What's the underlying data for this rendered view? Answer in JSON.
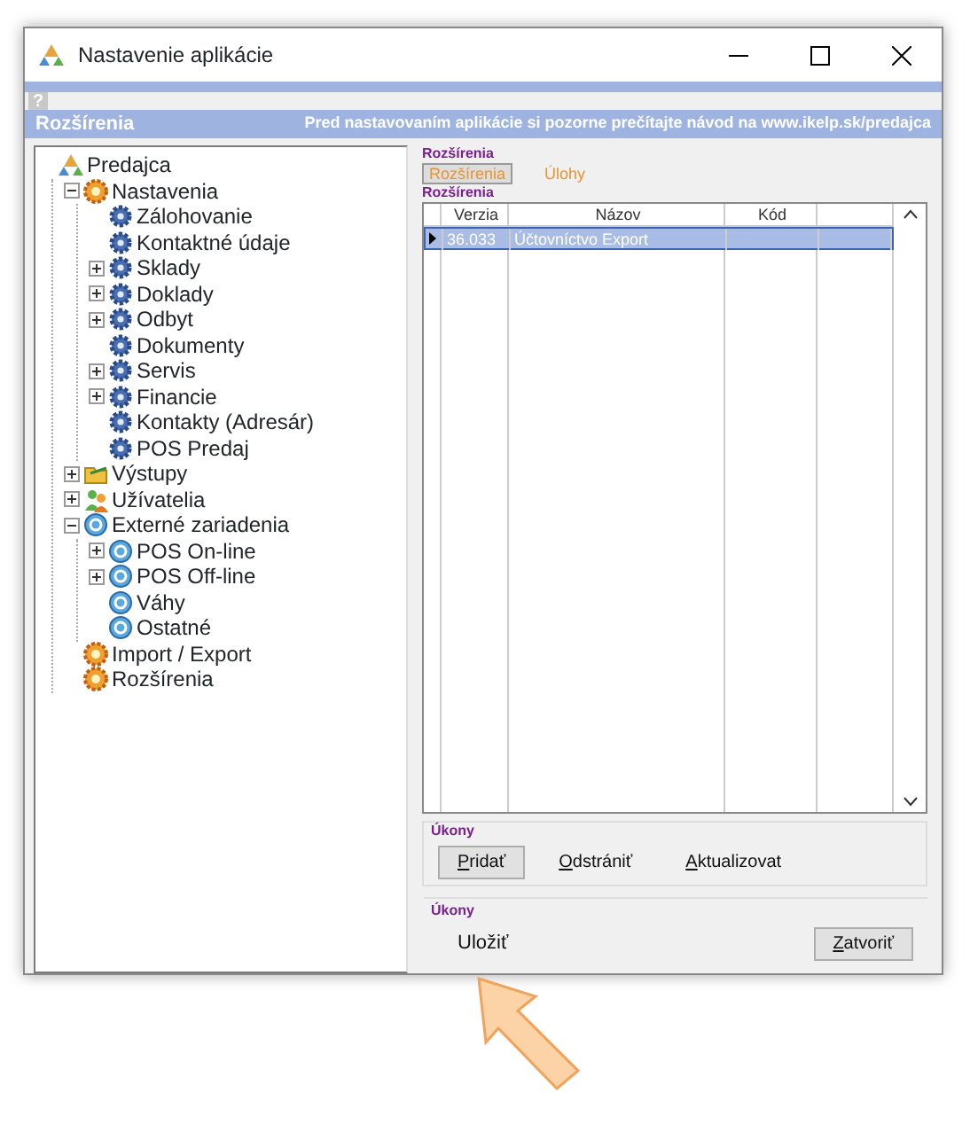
{
  "window": {
    "title": "Nastavenie aplikácie",
    "help": "?"
  },
  "header": {
    "title": "Rozšírenia",
    "notice": "Pred nastavovaním aplikácie si pozorne prečítajte návod na www.ikelp.sk/predajca"
  },
  "tree": [
    {
      "label": "Predajca",
      "kind": "vendor",
      "children": [
        {
          "label": "Nastavenia",
          "kind": "orange-gear",
          "expanded": true,
          "children": [
            {
              "label": "Zálohovanie",
              "kind": "blue-gear"
            },
            {
              "label": "Kontaktné údaje",
              "kind": "blue-gear"
            },
            {
              "label": "Sklady",
              "kind": "blue-gear",
              "expanded": false
            },
            {
              "label": "Doklady",
              "kind": "blue-gear",
              "expanded": false
            },
            {
              "label": "Odbyt",
              "kind": "blue-gear",
              "expanded": false
            },
            {
              "label": "Dokumenty",
              "kind": "blue-gear"
            },
            {
              "label": "Servis",
              "kind": "blue-gear",
              "expanded": false
            },
            {
              "label": "Financie",
              "kind": "blue-gear",
              "expanded": false
            },
            {
              "label": "Kontakty (Adresár)",
              "kind": "blue-gear"
            },
            {
              "label": "POS Predaj",
              "kind": "blue-gear"
            }
          ]
        },
        {
          "label": "Výstupy",
          "kind": "folder",
          "expanded": false
        },
        {
          "label": "Užívatelia",
          "kind": "users",
          "expanded": false
        },
        {
          "label": "Externé zariadenia",
          "kind": "device",
          "expanded": true,
          "children": [
            {
              "label": "POS On-line",
              "kind": "device",
              "expanded": false
            },
            {
              "label": "POS Off-line",
              "kind": "device",
              "expanded": false
            },
            {
              "label": "Váhy",
              "kind": "device"
            },
            {
              "label": "Ostatné",
              "kind": "device"
            }
          ]
        },
        {
          "label": "Import / Export",
          "kind": "orange-gear"
        },
        {
          "label": "Rozšírenia",
          "kind": "orange-gear"
        }
      ]
    }
  ],
  "panel": {
    "group_label": "Rozšírenia",
    "tabs": [
      {
        "label": "Rozšírenia",
        "selected": true
      },
      {
        "label": "Úlohy",
        "selected": false
      }
    ],
    "table_label": "Rozšírenia",
    "table": {
      "columns": [
        "Verzia",
        "Názov",
        "Kód"
      ],
      "rows": [
        {
          "cells": [
            "36.033",
            "Účtovníctvo Export",
            ""
          ],
          "selected": true
        }
      ]
    },
    "actions_label": "Úkony",
    "actions": [
      {
        "label": "Pridať",
        "kind": "raised"
      },
      {
        "label": "Odstrániť",
        "kind": "flat"
      },
      {
        "label": "Aktualizovat",
        "kind": "flat"
      }
    ]
  },
  "footer": {
    "label": "Úkony",
    "save": "Uložiť",
    "close": "Zatvoriť"
  }
}
